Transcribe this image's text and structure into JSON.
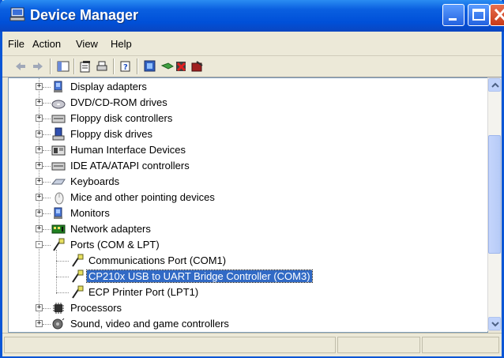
{
  "window": {
    "title": "Device Manager"
  },
  "menu": {
    "items": [
      "File",
      "Action",
      "View",
      "Help"
    ]
  },
  "toolbar": {
    "buttons": [
      "back-icon",
      "forward-icon",
      "show-hide-tree-icon",
      "properties-icon",
      "print-icon",
      "help-icon",
      "scan-hardware-icon",
      "update-driver-icon",
      "uninstall-icon",
      "disable-icon"
    ]
  },
  "tree": {
    "items": [
      {
        "label": "Display adapters",
        "expander": "+",
        "icon": "display-adapter-icon"
      },
      {
        "label": "DVD/CD-ROM drives",
        "expander": "+",
        "icon": "dvd-drive-icon"
      },
      {
        "label": "Floppy disk controllers",
        "expander": "+",
        "icon": "disk-controller-icon"
      },
      {
        "label": "Floppy disk drives",
        "expander": "+",
        "icon": "floppy-drive-icon"
      },
      {
        "label": "Human Interface Devices",
        "expander": "+",
        "icon": "hid-icon"
      },
      {
        "label": "IDE ATA/ATAPI controllers",
        "expander": "+",
        "icon": "ide-controller-icon"
      },
      {
        "label": "Keyboards",
        "expander": "+",
        "icon": "keyboard-icon"
      },
      {
        "label": "Mice and other pointing devices",
        "expander": "+",
        "icon": "mouse-icon"
      },
      {
        "label": "Monitors",
        "expander": "+",
        "icon": "monitor-icon"
      },
      {
        "label": "Network adapters",
        "expander": "+",
        "icon": "network-adapter-icon"
      },
      {
        "label": "Ports (COM & LPT)",
        "expander": "-",
        "icon": "port-icon"
      },
      {
        "label": "Processors",
        "expander": "+",
        "icon": "processor-icon"
      },
      {
        "label": "Sound, video and game controllers",
        "expander": "+",
        "icon": "sound-icon"
      }
    ],
    "ports_children": [
      {
        "label": "Communications Port (COM1)",
        "icon": "port-icon",
        "selected": false
      },
      {
        "label": "CP210x USB to UART Bridge Controller (COM3)",
        "icon": "port-icon",
        "selected": true
      },
      {
        "label": "ECP Printer Port (LPT1)",
        "icon": "port-icon",
        "selected": false
      }
    ]
  },
  "colors": {
    "titlebar": "#0a5fe0",
    "selection": "#316ac5"
  }
}
